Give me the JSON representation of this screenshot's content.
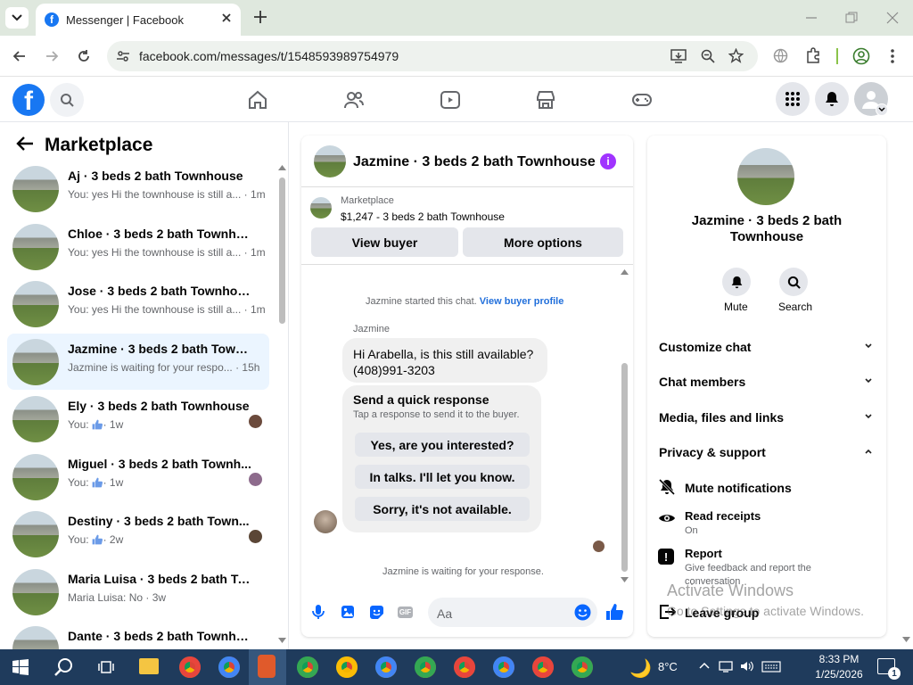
{
  "browser": {
    "tab_title": "Messenger | Facebook",
    "url": "facebook.com/messages/t/1548593989754979"
  },
  "left": {
    "title": "Marketplace",
    "conversations": [
      {
        "name": "Aj · 3 beds 2 bath Townhouse",
        "preview": "You: yes Hi the townhouse is still a...",
        "time": "· 1m"
      },
      {
        "name": "Chloe · 3 beds 2 bath Townhouse",
        "preview": "You: yes Hi the townhouse is still a...",
        "time": "· 1m"
      },
      {
        "name": "Jose · 3 beds 2 bath Townhouse",
        "preview": "You: yes Hi the townhouse is still a...",
        "time": "· 1m"
      },
      {
        "name": "Jazmine · 3 beds 2 bath Townho...",
        "preview": "Jazmine is waiting for your respo...",
        "time": "· 15h"
      },
      {
        "name": "Ely · 3 beds 2 bath Townhouse",
        "preview": "You:",
        "time": "· 1w"
      },
      {
        "name": "Miguel · 3 beds 2 bath Townh...",
        "preview": "You:",
        "time": "· 1w"
      },
      {
        "name": "Destiny · 3 beds 2 bath Town...",
        "preview": "You:",
        "time": "· 2w"
      },
      {
        "name": "Maria Luisa · 3 beds 2 bath Tow...",
        "preview": "Maria Luisa: No",
        "time": "· 3w"
      },
      {
        "name": "Dante · 3 beds 2 bath Townhouse",
        "preview": "",
        "time": ""
      }
    ]
  },
  "chat": {
    "title": "Jazmine · 3 beds 2 bath Townhouse",
    "listing_label": "Marketplace",
    "listing_price": "$1,247 - 3 beds 2 bath Townhouse",
    "view_buyer": "View buyer",
    "more_options": "More options",
    "started_text": "Jazmine started this chat.",
    "view_profile": "View buyer profile",
    "sender": "Jazmine",
    "message_line1": "Hi Arabella, is this still available?",
    "message_line2": "(408)991-3203",
    "quick_title": "Send a quick response",
    "quick_sub": "Tap a response to send it to the buyer.",
    "quick_options": [
      "Yes, are you interested?",
      "In talks. I'll let you know.",
      "Sorry, it's not available."
    ],
    "waiting": "Jazmine is waiting for your response.",
    "input_placeholder": "Aa"
  },
  "right": {
    "name_line1": "Jazmine · 3 beds 2 bath",
    "name_line2": "Townhouse",
    "mute": "Mute",
    "search": "Search",
    "sections": [
      "Customize chat",
      "Chat members",
      "Media, files and links",
      "Privacy & support"
    ],
    "mute_notifications": "Mute notifications",
    "read_receipts": "Read receipts",
    "read_receipts_state": "On",
    "report": "Report",
    "report_sub_1": "Give feedback and report the",
    "report_sub_2": "conversation",
    "leave_group": "Leave group"
  },
  "watermark": {
    "line1": "Activate Windows",
    "line2": "Go to Settings to activate Windows."
  },
  "taskbar": {
    "weather": "8°C",
    "time": "8:33 PM",
    "date": "1/25/2026",
    "notif_count": "1"
  },
  "colors": {
    "fb_blue": "#1877f2",
    "purple": "#a033ff",
    "taskbar": "#1f3b5c"
  }
}
